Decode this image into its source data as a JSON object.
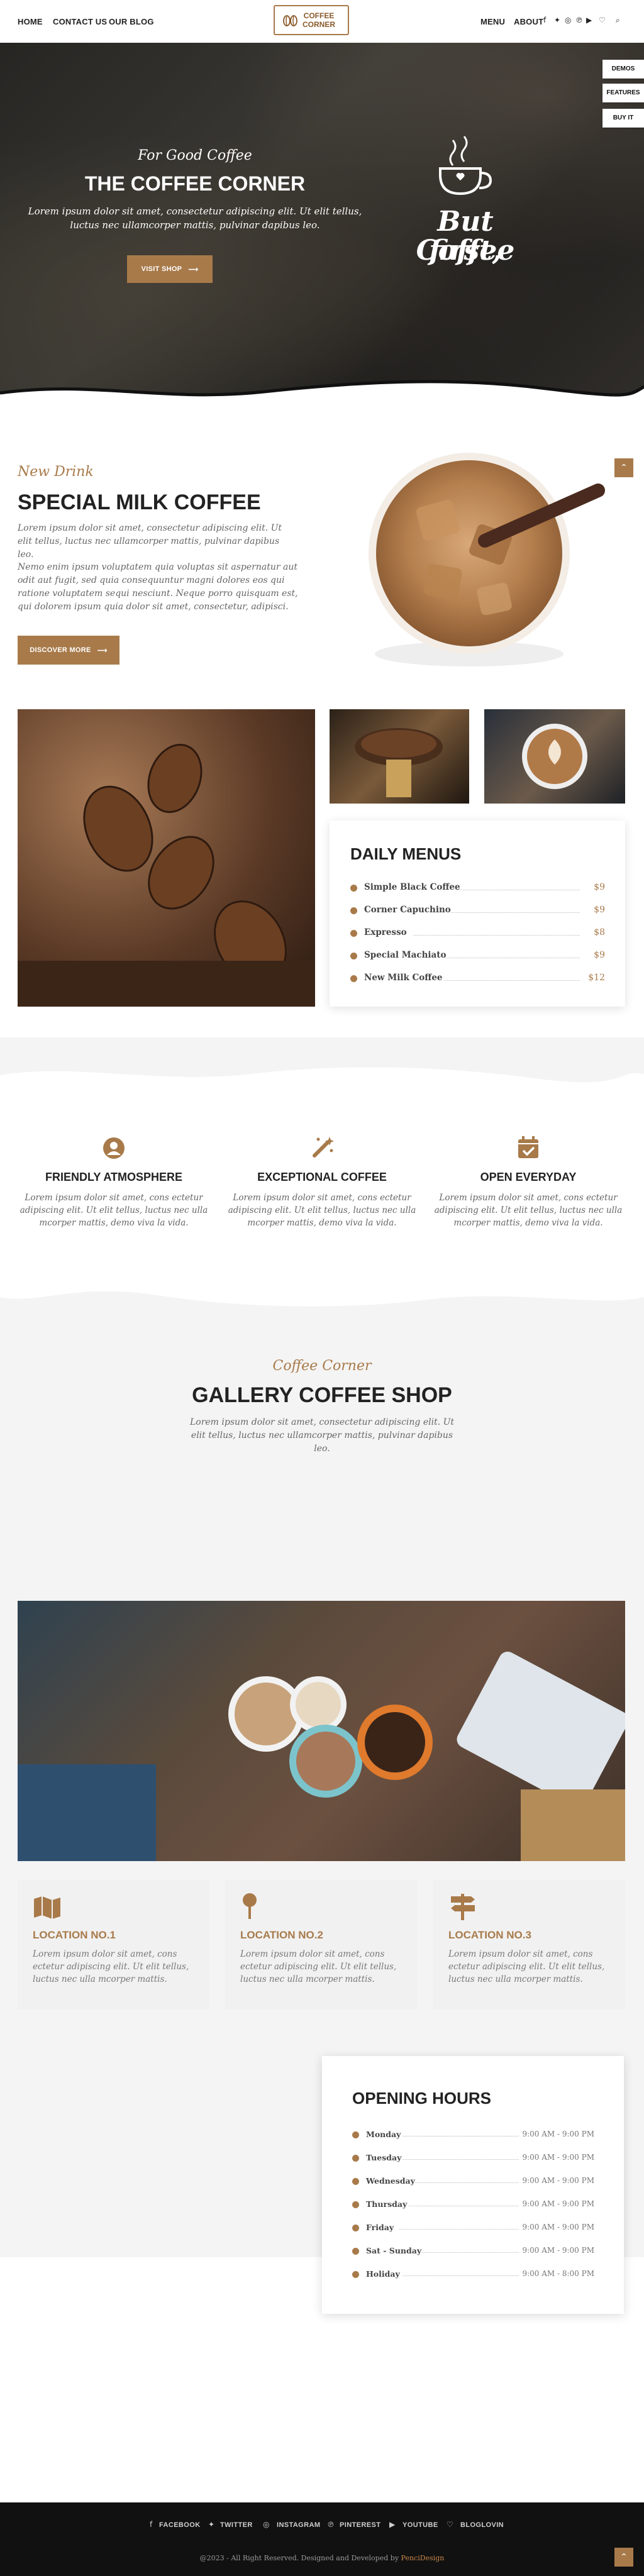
{
  "header": {
    "nav_left": [
      "HOME",
      "CONTACT US",
      "OUR BLOG"
    ],
    "nav_right": [
      "MENU",
      "ABOUT"
    ],
    "logo_line1": "COFFEE",
    "logo_line2": "CORNER",
    "social_icons": [
      "facebook-icon",
      "twitter-icon",
      "instagram-icon",
      "pinterest-icon",
      "youtube-icon",
      "bloglovin-icon",
      "search-icon"
    ]
  },
  "side_buttons": [
    "DEMOS",
    "FEATURES",
    "BUY IT"
  ],
  "hero": {
    "kicker": "For Good Coffee",
    "title": "THE COFFEE CORNER",
    "text": "Lorem ipsum dolor sit amet, consectetur adipiscing elit. Ut elit tellus, luctus nec ullamcorper mattis, pulvinar dapibus leo.",
    "button": "VISIT SHOP",
    "badge_line1": "But first,",
    "badge_line2": "Coffee"
  },
  "special": {
    "kicker": "New Drink",
    "title": "SPECIAL MILK COFFEE",
    "p1": "Lorem ipsum dolor sit amet, consectetur adipiscing elit. Ut elit tellus, luctus nec ullamcorper mattis, pulvinar dapibus leo.",
    "p2": "Nemo enim ipsum voluptatem quia voluptas sit aspernatur aut odit aut fugit, sed quia consequuntur magni dolores eos qui ratione voluptatem sequi nesciunt. Neque porro quisquam est, qui dolorem ipsum quia dolor sit amet, consectetur, adipisci.",
    "button": "DISCOVER MORE"
  },
  "menus": {
    "title": "DAILY MENUS",
    "items": [
      {
        "name": "Simple Black Coffee",
        "price": "$9"
      },
      {
        "name": "Corner Capuchino",
        "price": "$9"
      },
      {
        "name": "Expresso",
        "price": "$8"
      },
      {
        "name": "Special Machiato",
        "price": "$9"
      },
      {
        "name": "New Milk Coffee",
        "price": "$12"
      }
    ]
  },
  "features": [
    {
      "icon": "user-circle-icon",
      "title": "FRIENDLY ATMOSPHERE",
      "text": "Lorem ipsum dolor sit amet, cons ectetur adipiscing elit. Ut elit tellus, luctus nec ulla mcorper mattis, demo viva la vida."
    },
    {
      "icon": "magic-wand-icon",
      "title": "EXCEPTIONAL COFFEE",
      "text": "Lorem ipsum dolor sit amet, cons ectetur adipiscing elit. Ut elit tellus, luctus nec ulla mcorper mattis, demo viva la vida."
    },
    {
      "icon": "calendar-check-icon",
      "title": "OPEN EVERYDAY",
      "text": "Lorem ipsum dolor sit amet, cons ectetur adipiscing elit. Ut elit tellus, luctus nec ulla mcorper mattis, demo viva la vida."
    }
  ],
  "gallery": {
    "kicker": "Coffee Corner",
    "title": "GALLERY COFFEE SHOP",
    "text": "Lorem ipsum dolor sit amet, consectetur adipiscing elit. Ut elit tellus, luctus nec ullamcorper mattis, pulvinar dapibus leo."
  },
  "locations": [
    {
      "icon": "map-icon",
      "title": "LOCATION NO.1",
      "text": "Lorem ipsum dolor sit amet, cons ectetur adipiscing elit. Ut elit tellus, luctus nec ulla mcorper mattis."
    },
    {
      "icon": "map-pin-icon",
      "title": "LOCATION NO.2",
      "text": "Lorem ipsum dolor sit amet, cons ectetur adipiscing elit. Ut elit tellus, luctus nec ulla mcorper mattis."
    },
    {
      "icon": "signpost-icon",
      "title": "LOCATION NO.3",
      "text": "Lorem ipsum dolor sit amet, cons ectetur adipiscing elit. Ut elit tellus, luctus nec ulla mcorper mattis."
    }
  ],
  "hours": {
    "title": "OPENING HOURS",
    "rows": [
      {
        "day": "Monday",
        "time": "9:00 AM - 9:00 PM"
      },
      {
        "day": "Tuesday",
        "time": "9:00 AM - 9:00 PM"
      },
      {
        "day": "Wednesday",
        "time": "9:00 AM - 9:00 PM"
      },
      {
        "day": "Thursday",
        "time": "9:00 AM - 9:00 PM"
      },
      {
        "day": "Friday",
        "time": "9:00 AM - 9:00 PM"
      },
      {
        "day": "Sat - Sunday",
        "time": "9:00 AM - 9:00 PM"
      },
      {
        "day": "Holiday",
        "time": "9:00 AM - 8:00 PM"
      }
    ]
  },
  "footer": {
    "links": [
      "FACEBOOK",
      "TWITTER",
      "INSTAGRAM",
      "PINTEREST",
      "YOUTUBE",
      "BLOGLOVIN"
    ],
    "copyright": "@2023 - All Right Reserved. Designed and Developed by",
    "credit": "PenciDesign"
  },
  "colors": {
    "accent": "#a87a4a",
    "dark": "#111111",
    "light_bg": "#f4f4f4"
  }
}
